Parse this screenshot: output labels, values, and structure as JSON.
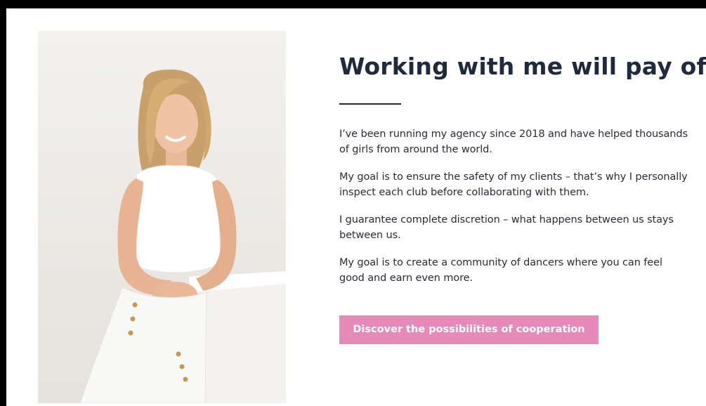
{
  "section": {
    "title": "Working with me will pay off!",
    "paragraphs": [
      "I’ve been running my agency since 2018 and have helped thousands of girls from around the world.",
      "My goal is to ensure the safety of my clients – that’s why I personally inspect each club before collaborating with them.",
      "I guarantee complete discretion – what happens between us stays between us.",
      "My goal is to create a community of dancers where you can feel good and earn even more."
    ],
    "cta_label": "Discover the possibilities of cooperation"
  },
  "colors": {
    "title": "#1f2a3d",
    "cta_background": "#e68ab9",
    "page_background": "#ffffff",
    "frame": "#000000"
  }
}
